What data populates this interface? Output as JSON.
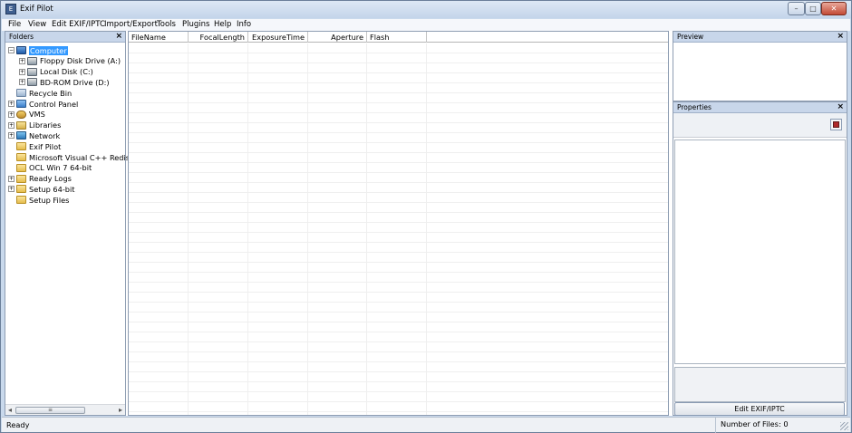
{
  "window": {
    "title": "Exif Pilot",
    "controls": {
      "minimize": "–",
      "maximize": "□",
      "close": "✕"
    }
  },
  "menu": [
    "File",
    "View",
    "Edit EXIF/IPTC",
    "Import/Export",
    "Tools",
    "Plugins",
    "Help",
    "Info"
  ],
  "folders": {
    "title": "Folders",
    "close": "×",
    "tree": [
      {
        "label": "Computer",
        "icon": "computer-icon",
        "level": 0,
        "expander": "−",
        "selected": true
      },
      {
        "label": "Floppy Disk Drive (A:)",
        "icon": "drive-icon",
        "level": 1,
        "expander": "+"
      },
      {
        "label": "Local Disk (C:)",
        "icon": "drive-icon",
        "level": 1,
        "expander": "+"
      },
      {
        "label": "BD-ROM Drive (D:)",
        "icon": "drive-icon",
        "level": 1,
        "expander": "+"
      },
      {
        "label": "Recycle Bin",
        "icon": "recycle-bin-icon",
        "level": 0,
        "expander": ""
      },
      {
        "label": "Control Panel",
        "icon": "control-panel-icon",
        "level": 0,
        "expander": "+"
      },
      {
        "label": "VMS",
        "icon": "user-folder-icon",
        "level": 0,
        "expander": "+"
      },
      {
        "label": "Libraries",
        "icon": "libraries-icon",
        "level": 0,
        "expander": "+"
      },
      {
        "label": "Network",
        "icon": "network-icon",
        "level": 0,
        "expander": "+"
      },
      {
        "label": "Exif Pilot",
        "icon": "folder-icon",
        "level": 0,
        "expander": ""
      },
      {
        "label": "Microsoft Visual C++ Redistril",
        "icon": "folder-icon",
        "level": 0,
        "expander": ""
      },
      {
        "label": "OCL Win 7 64-bit",
        "icon": "folder-icon",
        "level": 0,
        "expander": ""
      },
      {
        "label": "Ready Logs",
        "icon": "folder-icon",
        "level": 0,
        "expander": "+"
      },
      {
        "label": "Setup 64-bit",
        "icon": "folder-icon",
        "level": 0,
        "expander": "+"
      },
      {
        "label": "Setup Files",
        "icon": "folder-icon",
        "level": 0,
        "expander": ""
      }
    ],
    "scroll_left": "◂",
    "scroll_right": "▸",
    "scroll_grip": "≡"
  },
  "file_list": {
    "columns": [
      "FileName",
      "FocalLength",
      "ExposureTime",
      "Aperture",
      "Flash"
    ],
    "rows": []
  },
  "preview": {
    "title": "Preview",
    "close": "×"
  },
  "properties": {
    "title": "Properties",
    "close": "×",
    "edit_button": "Edit EXIF/IPTC"
  },
  "status": {
    "left": "Ready",
    "right": "Number of Files: 0"
  }
}
